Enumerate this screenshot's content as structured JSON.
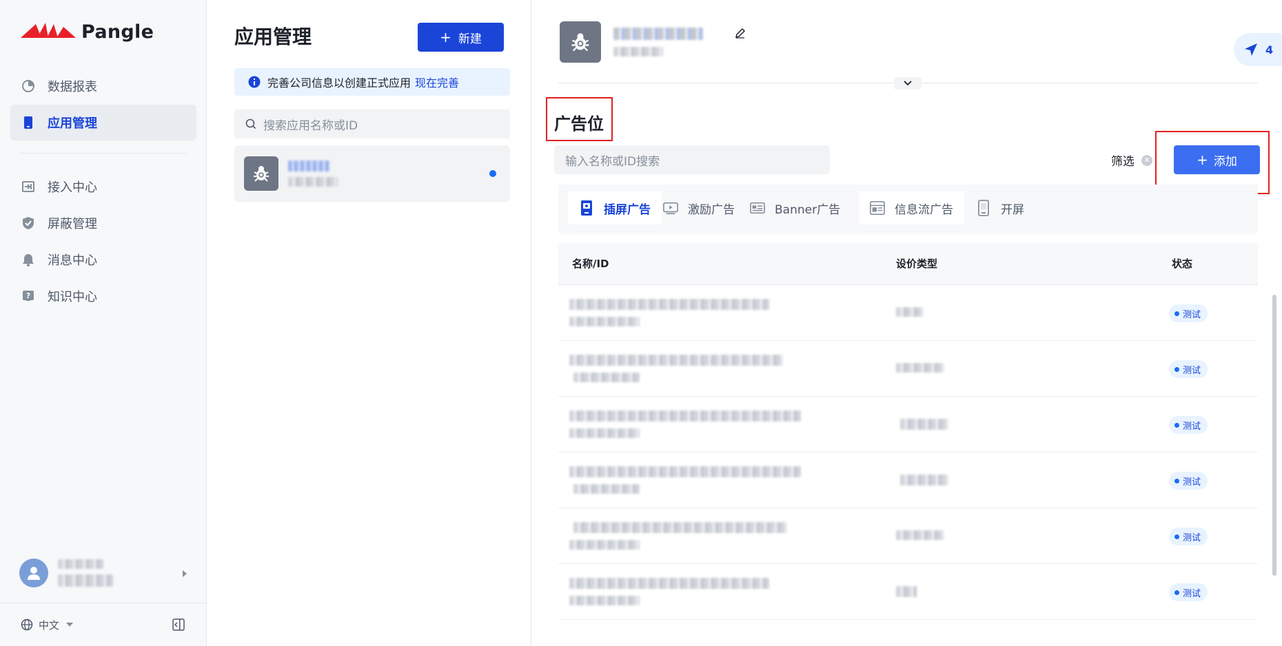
{
  "colors": {
    "primary": "#1a45d8",
    "accent": "#3b6ef0",
    "highlight_box": "#e02020",
    "brand_red": "#e8202a"
  },
  "brand": {
    "name": "Pangle"
  },
  "nav": {
    "items": [
      {
        "label": "数据报表",
        "icon": "pie-chart-icon"
      },
      {
        "label": "应用管理",
        "icon": "phone-app-icon"
      },
      {
        "label": "接入中心",
        "icon": "import-icon"
      },
      {
        "label": "屏蔽管理",
        "icon": "shield-icon"
      },
      {
        "label": "消息中心",
        "icon": "bell-icon"
      },
      {
        "label": "知识中心",
        "icon": "question-icon"
      }
    ],
    "language": "中文"
  },
  "apps_panel": {
    "title": "应用管理",
    "new_button": "新建",
    "notice_text": "完善公司信息以创建正式应用",
    "notice_link": "现在完善",
    "search_placeholder": "搜索应用名称或ID"
  },
  "header": {
    "notification_count": "4"
  },
  "ad_slots": {
    "title": "广告位",
    "search_placeholder": "输入名称或ID搜索",
    "filter_label": "筛选",
    "add_button": "添加",
    "tabs": [
      {
        "label": "插屏广告",
        "icon": "interstitial-ad-icon"
      },
      {
        "label": "激励广告",
        "icon": "rewarded-video-icon"
      },
      {
        "label": "Banner广告",
        "icon": "banner-ad-icon"
      },
      {
        "label": "信息流广告",
        "icon": "feed-ad-icon"
      },
      {
        "label": "开屏",
        "icon": "splash-screen-icon"
      }
    ],
    "columns": {
      "name": "名称/ID",
      "type": "设价类型",
      "status": "状态"
    },
    "rows": [
      {
        "status": "测试"
      },
      {
        "status": "测试"
      },
      {
        "status": "测试"
      },
      {
        "status": "测试"
      },
      {
        "status": "测试"
      },
      {
        "status": "测试"
      }
    ]
  }
}
